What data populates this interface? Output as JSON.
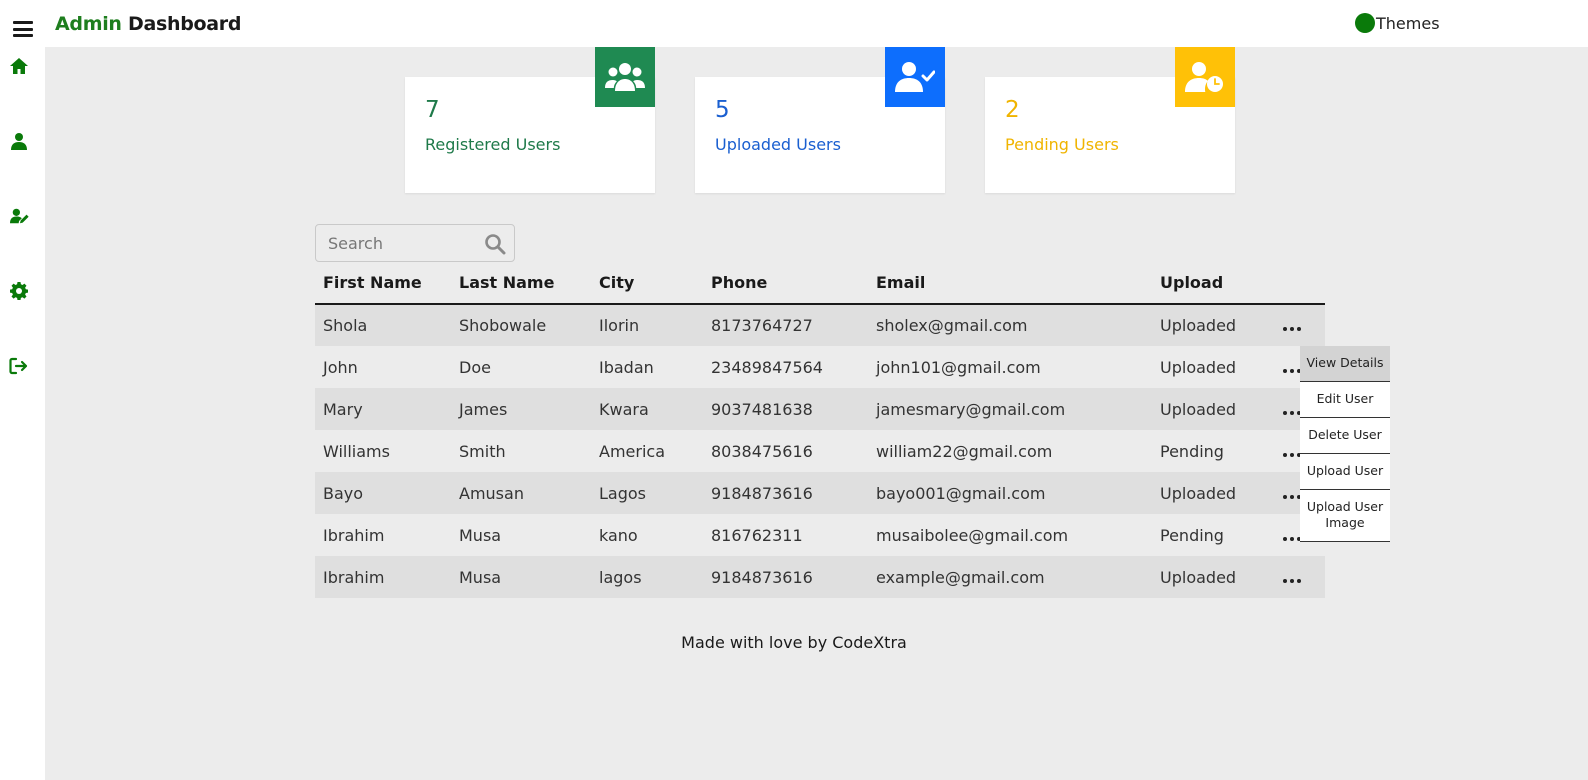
{
  "brand": {
    "part1": "Admin",
    "part2": "Dashboard"
  },
  "themes_label": "Themes",
  "sidebar": {
    "icons": [
      "home-icon",
      "user-icon",
      "user-edit-icon",
      "gear-icon",
      "sign-out-icon"
    ]
  },
  "cards": [
    {
      "count": "7",
      "label": "Registered Users",
      "color": "#1f8a52",
      "icon": "users-icon"
    },
    {
      "count": "5",
      "label": "Uploaded Users",
      "color": "#0d6efd",
      "icon": "user-check-icon"
    },
    {
      "count": "2",
      "label": "Pending Users",
      "color": "#ffc107",
      "icon": "user-clock-icon"
    }
  ],
  "search": {
    "placeholder": "Search"
  },
  "table": {
    "headers": [
      "First Name",
      "Last Name",
      "City",
      "Phone",
      "Email",
      "Upload"
    ],
    "rows": [
      [
        "Shola",
        "Shobowale",
        "Ilorin",
        "8173764727",
        "sholex@gmail.com",
        "Uploaded"
      ],
      [
        "John",
        "Doe",
        "Ibadan",
        "23489847564",
        "john101@gmail.com",
        "Uploaded"
      ],
      [
        "Mary",
        "James",
        "Kwara",
        "9037481638",
        "jamesmary@gmail.com",
        "Uploaded"
      ],
      [
        "Williams",
        "Smith",
        "America",
        "8038475616",
        "william22@gmail.com",
        "Pending"
      ],
      [
        "Bayo",
        "Amusan",
        "Lagos",
        "9184873616",
        "bayo001@gmail.com",
        "Uploaded"
      ],
      [
        "Ibrahim",
        "Musa",
        "kano",
        "816762311",
        "musaibolee@gmail.com",
        "Pending"
      ],
      [
        "Ibrahim",
        "Musa",
        "lagos",
        "9184873616",
        "example@gmail.com",
        "Uploaded"
      ]
    ]
  },
  "menu": {
    "items": [
      "View Details",
      "Edit User",
      "Delete User",
      "Upload User",
      "Upload User Image"
    ]
  },
  "footer": "Made with love by CodeXtra"
}
